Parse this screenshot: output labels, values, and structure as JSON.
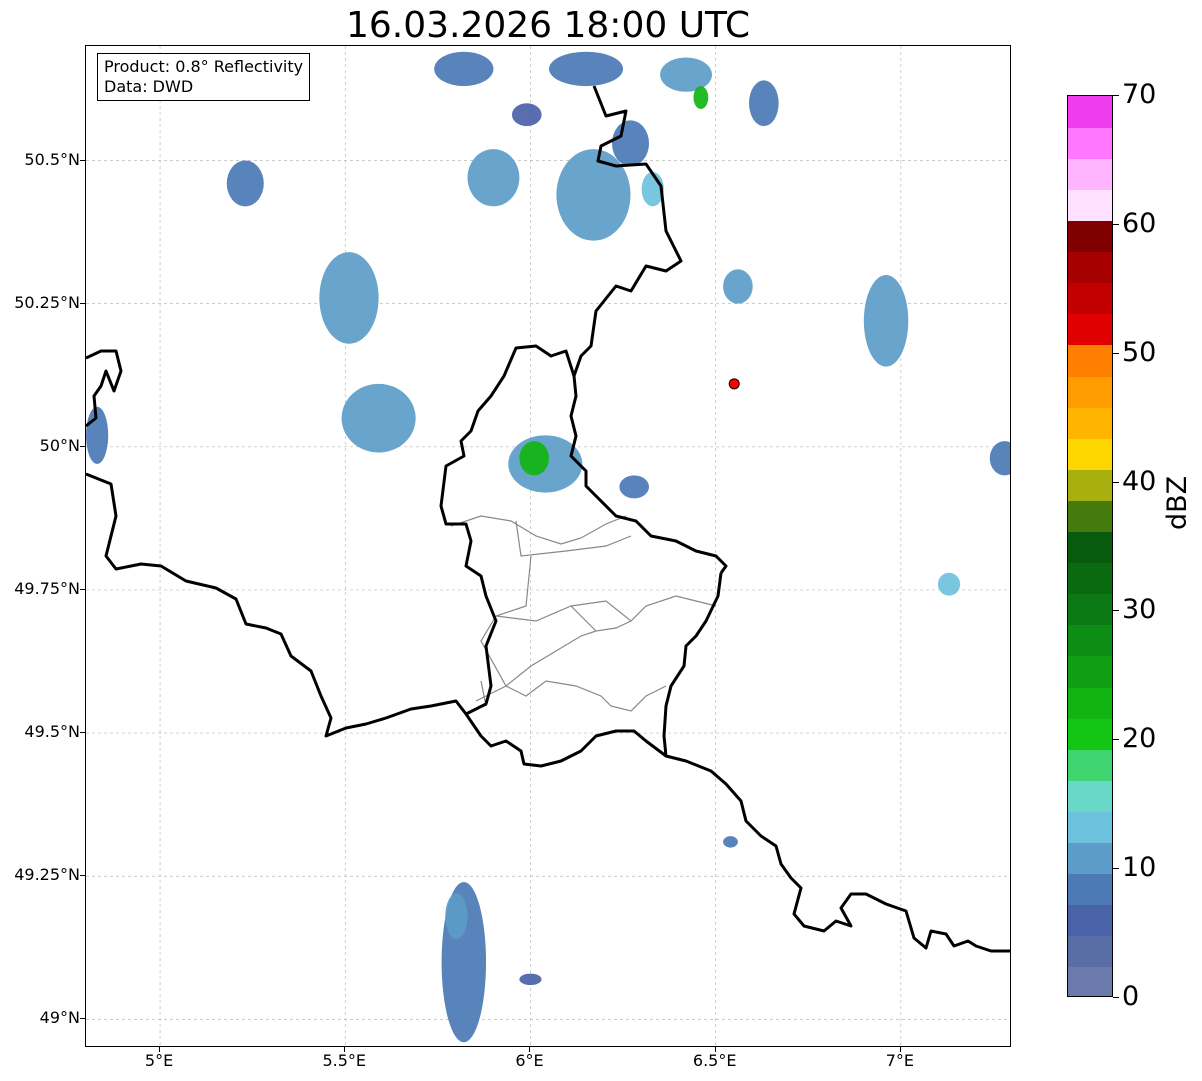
{
  "title": "16.03.2026 18:00 UTC",
  "info": {
    "line1": "Product: 0.8° Reflectivity",
    "line2": "Data: DWD"
  },
  "map_extent": {
    "lon": [
      4.8,
      7.3
    ],
    "lat": [
      48.95,
      50.7
    ]
  },
  "lat_ticks": [
    {
      "value": 50.5,
      "label": "50.5°N"
    },
    {
      "value": 50.25,
      "label": "50.25°N"
    },
    {
      "value": 50.0,
      "label": "50°N"
    },
    {
      "value": 49.75,
      "label": "49.75°N"
    },
    {
      "value": 49.5,
      "label": "49.5°N"
    },
    {
      "value": 49.25,
      "label": "49.25°N"
    },
    {
      "value": 49.0,
      "label": "49°N"
    }
  ],
  "lon_ticks": [
    {
      "value": 5.0,
      "label": "5°E"
    },
    {
      "value": 5.5,
      "label": "5.5°E"
    },
    {
      "value": 6.0,
      "label": "6°E"
    },
    {
      "value": 6.5,
      "label": "6.5°E"
    },
    {
      "value": 7.0,
      "label": "7°E"
    }
  ],
  "radar_site": {
    "lon": 6.55,
    "lat": 50.11,
    "color": "#ff0000"
  },
  "colorbar": {
    "unit": "dBZ",
    "min": 0,
    "max": 70,
    "labels": [
      0,
      10,
      20,
      30,
      40,
      50,
      60,
      70
    ],
    "colors": [
      "#6a7aab",
      "#5a6ea6",
      "#4a62a8",
      "#4b7ab5",
      "#5b9cc8",
      "#6cc1dd",
      "#6ad8c8",
      "#40d470",
      "#14c614",
      "#12b414",
      "#109f14",
      "#0e8d14",
      "#0b7a14",
      "#0a6a10",
      "#085a0c",
      "#457a0e",
      "#a8b010",
      "#ffd700",
      "#ffb500",
      "#ff9c00",
      "#ff7f00",
      "#e00000",
      "#c20000",
      "#a60000",
      "#800000",
      "#ffe0ff",
      "#ffb4ff",
      "#ff78ff",
      "#ee3cee"
    ]
  },
  "echoes": [
    {
      "lon": 5.82,
      "lat": 50.66,
      "rx": 0.08,
      "ry": 0.03,
      "dbz": 8
    },
    {
      "lon": 6.15,
      "lat": 50.66,
      "rx": 0.1,
      "ry": 0.03,
      "dbz": 9
    },
    {
      "lon": 6.42,
      "lat": 50.65,
      "rx": 0.07,
      "ry": 0.03,
      "dbz": 10
    },
    {
      "lon": 6.46,
      "lat": 50.61,
      "rx": 0.02,
      "ry": 0.02,
      "dbz": 22
    },
    {
      "lon": 6.63,
      "lat": 50.6,
      "rx": 0.04,
      "ry": 0.04,
      "dbz": 8
    },
    {
      "lon": 5.99,
      "lat": 50.58,
      "rx": 0.04,
      "ry": 0.02,
      "dbz": 7
    },
    {
      "lon": 6.27,
      "lat": 50.53,
      "rx": 0.05,
      "ry": 0.04,
      "dbz": 9
    },
    {
      "lon": 5.9,
      "lat": 50.47,
      "rx": 0.07,
      "ry": 0.05,
      "dbz": 12
    },
    {
      "lon": 6.17,
      "lat": 50.44,
      "rx": 0.1,
      "ry": 0.08,
      "dbz": 10
    },
    {
      "lon": 6.33,
      "lat": 50.45,
      "rx": 0.03,
      "ry": 0.03,
      "dbz": 13
    },
    {
      "lon": 5.23,
      "lat": 50.46,
      "rx": 0.05,
      "ry": 0.04,
      "dbz": 8
    },
    {
      "lon": 5.51,
      "lat": 50.26,
      "rx": 0.08,
      "ry": 0.08,
      "dbz": 11
    },
    {
      "lon": 6.56,
      "lat": 50.28,
      "rx": 0.04,
      "ry": 0.03,
      "dbz": 11
    },
    {
      "lon": 6.96,
      "lat": 50.22,
      "rx": 0.06,
      "ry": 0.08,
      "dbz": 10
    },
    {
      "lon": 5.59,
      "lat": 50.05,
      "rx": 0.1,
      "ry": 0.06,
      "dbz": 11
    },
    {
      "lon": 6.04,
      "lat": 49.97,
      "rx": 0.1,
      "ry": 0.05,
      "dbz": 12
    },
    {
      "lon": 6.01,
      "lat": 49.98,
      "rx": 0.04,
      "ry": 0.03,
      "dbz": 24
    },
    {
      "lon": 6.28,
      "lat": 49.93,
      "rx": 0.04,
      "ry": 0.02,
      "dbz": 8
    },
    {
      "lon": 4.83,
      "lat": 50.02,
      "rx": 0.03,
      "ry": 0.05,
      "dbz": 8
    },
    {
      "lon": 7.28,
      "lat": 49.98,
      "rx": 0.04,
      "ry": 0.03,
      "dbz": 8
    },
    {
      "lon": 7.13,
      "lat": 49.76,
      "rx": 0.03,
      "ry": 0.02,
      "dbz": 13
    },
    {
      "lon": 5.82,
      "lat": 49.1,
      "rx": 0.06,
      "ry": 0.14,
      "dbz": 9
    },
    {
      "lon": 5.8,
      "lat": 49.18,
      "rx": 0.03,
      "ry": 0.04,
      "dbz": 12
    },
    {
      "lon": 6.0,
      "lat": 49.07,
      "rx": 0.03,
      "ry": 0.01,
      "dbz": 7
    },
    {
      "lon": 6.54,
      "lat": 49.31,
      "rx": 0.02,
      "ry": 0.01,
      "dbz": 8
    }
  ]
}
